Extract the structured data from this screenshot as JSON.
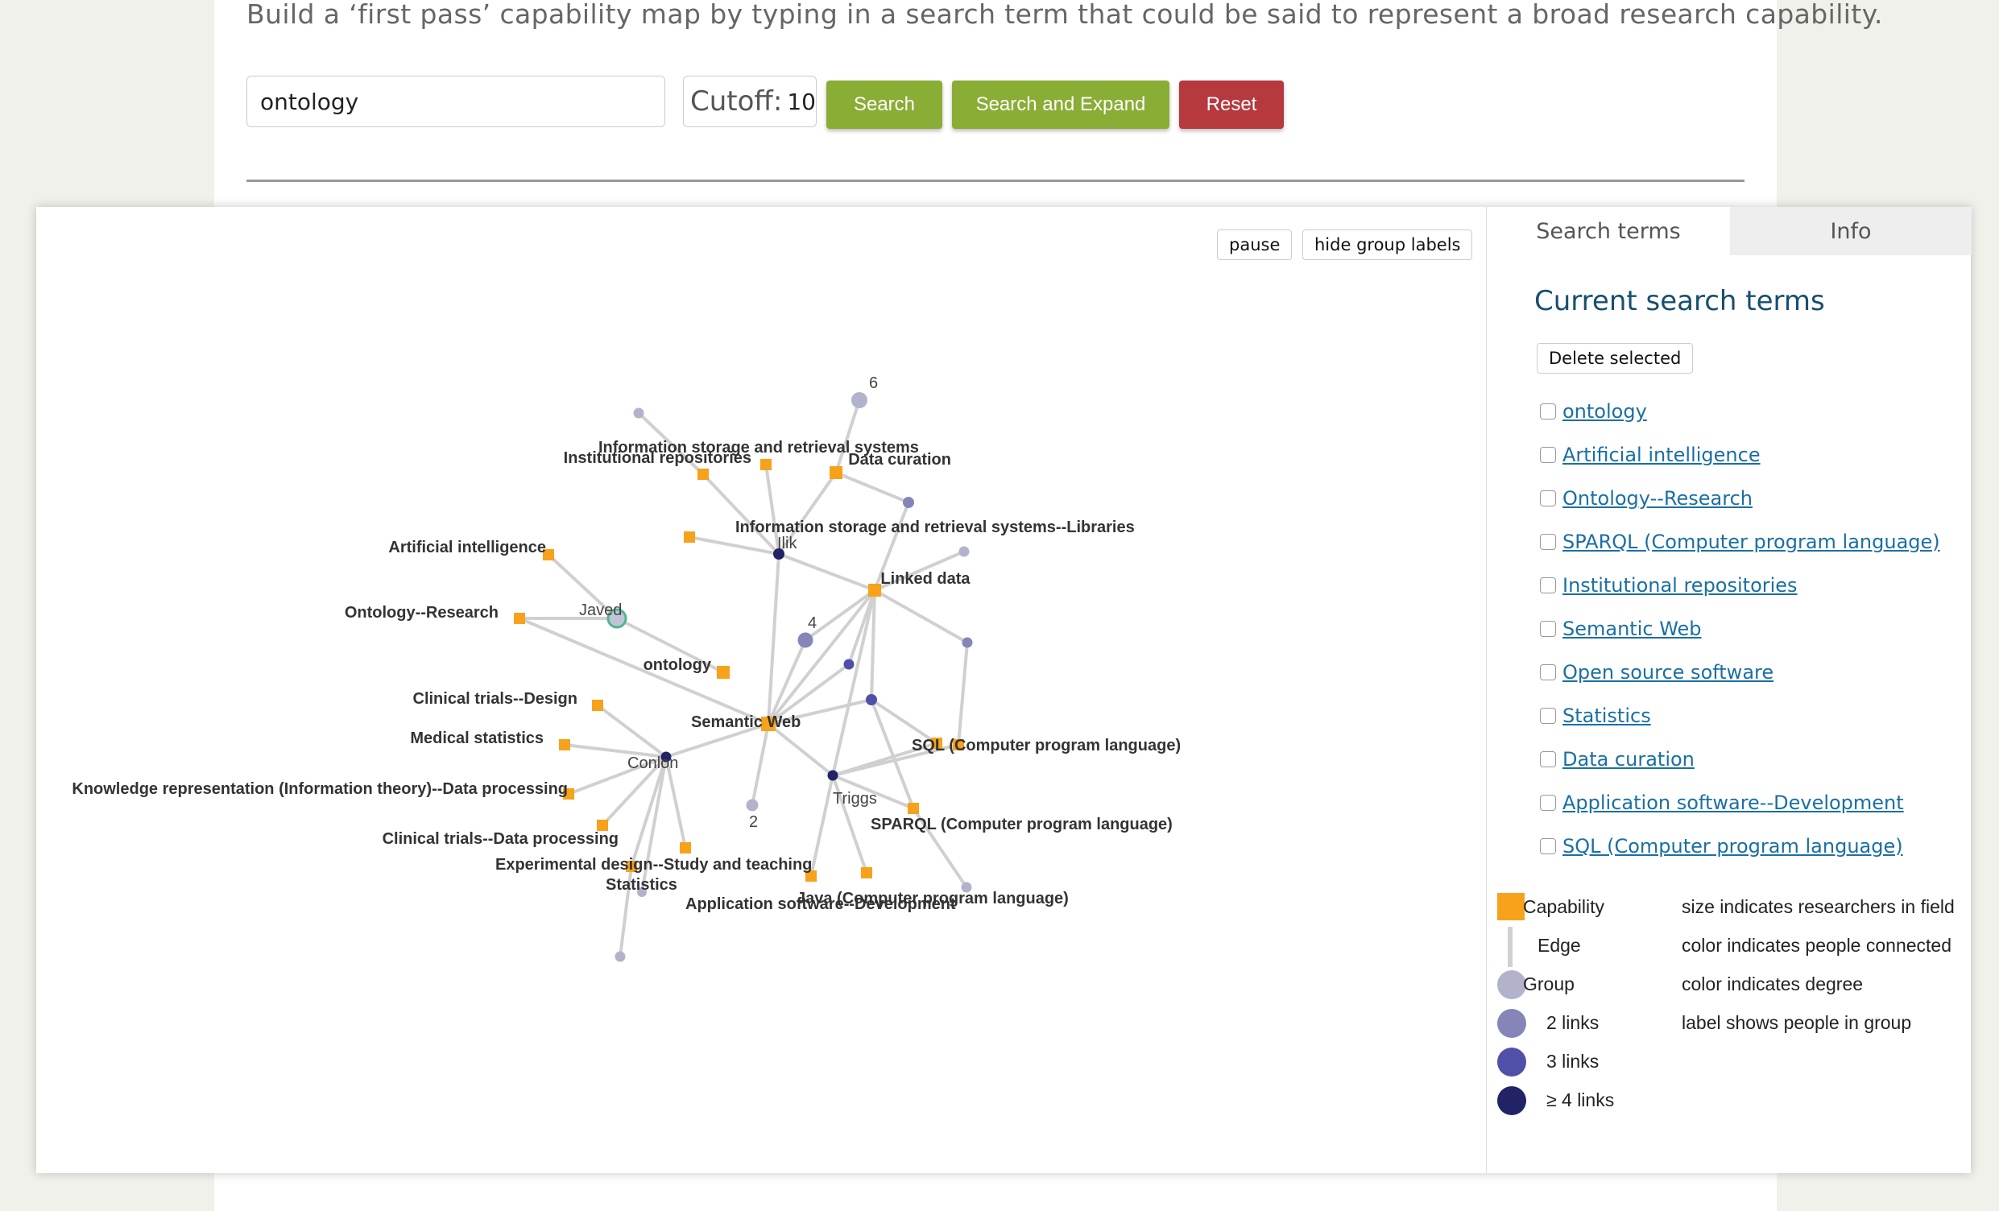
{
  "intro": "Build a ‘first pass’ capability map by typing in a search term that could be said to represent a broad research capability.",
  "form": {
    "search_value": "ontology",
    "cutoff_label": "Cutoff:",
    "cutoff_value": "10",
    "search_label": "Search",
    "search_expand_label": "Search and Expand",
    "reset_label": "Reset"
  },
  "graph_controls": {
    "pause_label": "pause",
    "hide_labels_label": "hide group labels"
  },
  "colors": {
    "capability": "#f7a21b",
    "edge": "#d0d0d0",
    "group_1": "#b2b2cc",
    "group_2": "#8585b8",
    "group_3": "#5050a8",
    "group_4": "#222266",
    "highlight": "#4fb58f",
    "button_green": "#8aad35",
    "button_red": "#b5393d"
  },
  "graph": {
    "capability_labels": [
      "Information storage and retrieval systems",
      "Institutional repositories",
      "Data curation",
      "Information storage and retrieval systems--Libraries",
      "Artificial intelligence",
      "Linked data",
      "Ontology--Research",
      "ontology",
      "Clinical trials--Design",
      "Semantic Web",
      "Medical statistics",
      "SQL (Computer program language)",
      "Knowledge representation (Information theory)--Data processing",
      "SPARQL (Computer program language)",
      "Clinical trials--Data processing",
      "Experimental design--Study and teaching",
      "Statistics",
      "Application software--Development",
      "Java (Computer program language)"
    ],
    "group_labels": [
      "Ilik",
      "Javed",
      "Conlon",
      "Triggs",
      "6",
      "4",
      "2"
    ]
  },
  "side": {
    "tab_search": "Search terms",
    "tab_info": "Info",
    "heading": "Current search terms",
    "delete_label": "Delete selected",
    "terms": [
      "ontology",
      "Artificial intelligence",
      "Ontology--Research",
      "SPARQL (Computer program language)",
      "Institutional repositories",
      "Semantic Web",
      "Open source software",
      "Statistics",
      "Data curation",
      "Application software--Development",
      "SQL (Computer program language)"
    ],
    "legend": [
      {
        "name": "Capability",
        "desc": "size indicates researchers in field",
        "symbol": "square-icon"
      },
      {
        "name": "Edge",
        "desc": "color indicates people connected",
        "symbol": "edge-line-icon"
      },
      {
        "name": "Group",
        "desc": "color indicates degree",
        "symbol": "circle-icon"
      },
      {
        "name": "2 links",
        "desc": "label shows people in group",
        "symbol": "circle-icon"
      },
      {
        "name": "3 links",
        "desc": "",
        "symbol": "circle-icon"
      },
      {
        "name": "≥ 4 links",
        "desc": "",
        "symbol": "circle-icon"
      }
    ]
  }
}
